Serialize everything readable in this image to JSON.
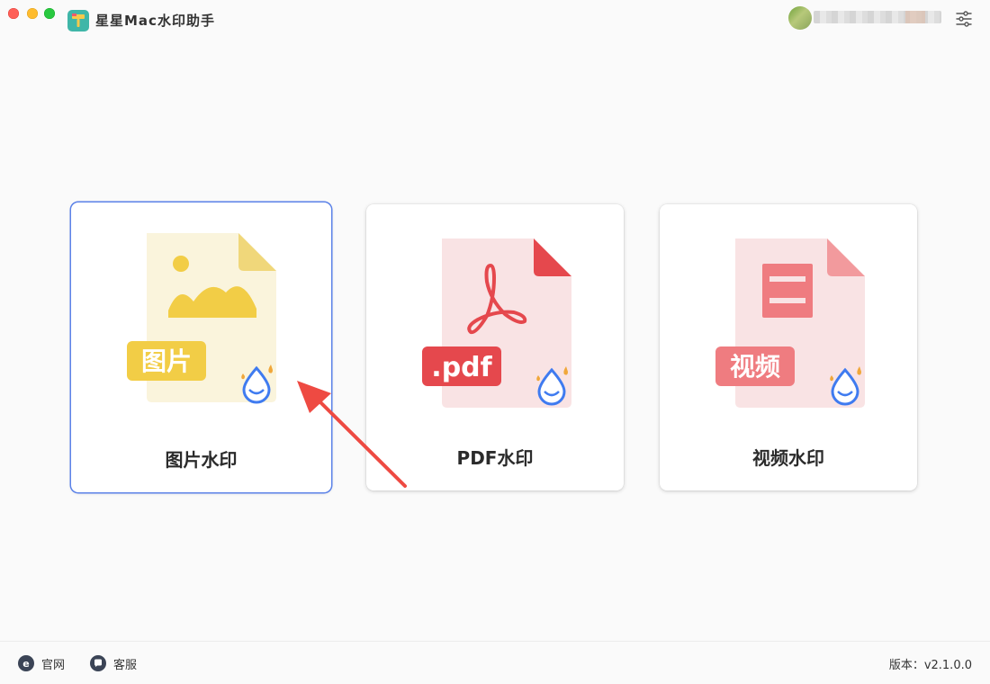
{
  "app": {
    "title": "星星Mac水印助手"
  },
  "cards": [
    {
      "label": "图片水印",
      "badge": "图片",
      "accent": "#f2cd46",
      "paper": "#faf4dc",
      "fold": "#f0d77a"
    },
    {
      "label": "PDF水印",
      "badge": ".pdf",
      "accent": "#e5484d",
      "paper": "#f9e3e4",
      "fold": "#e5484d"
    },
    {
      "label": "视频水印",
      "badge": "视频",
      "accent": "#ef7c80",
      "paper": "#f9e3e4",
      "fold": "#f29a9d"
    }
  ],
  "footer": {
    "website": "官网",
    "support": "客服",
    "version": "版本：v2.1.0.0"
  },
  "colors": {
    "selected_border": "#5b82e8",
    "arrow": "#ee4a42",
    "drop_icon": "#3f7bf0"
  }
}
